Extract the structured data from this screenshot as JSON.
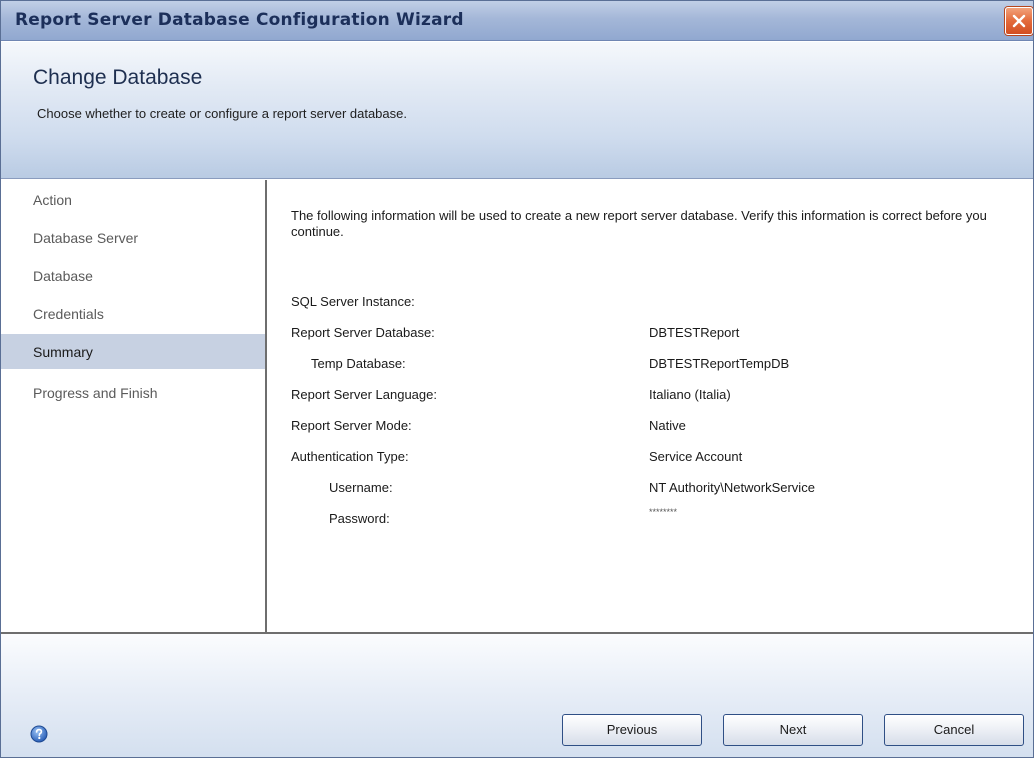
{
  "window": {
    "title": "Report Server Database Configuration Wizard"
  },
  "header": {
    "title": "Change Database",
    "subtitle": "Choose whether to create or configure a report server database."
  },
  "sidebar": {
    "items": [
      {
        "label": "Action"
      },
      {
        "label": "Database Server"
      },
      {
        "label": "Database"
      },
      {
        "label": "Credentials"
      },
      {
        "label": "Summary",
        "active": true
      },
      {
        "label": "Progress and Finish"
      }
    ]
  },
  "summary": {
    "intro": "The following information will be used to create a new report server database. Verify this information is correct before you continue.",
    "rows": [
      {
        "label": "SQL Server Instance:",
        "value": ""
      },
      {
        "label": "Report Server Database:",
        "value": "DBTESTReport"
      },
      {
        "label": "Temp Database:",
        "value": "DBTESTReportTempDB"
      },
      {
        "label": "Report Server Language:",
        "value": "Italiano (Italia)"
      },
      {
        "label": "Report Server Mode:",
        "value": "Native"
      },
      {
        "label": "Authentication Type:",
        "value": "Service Account"
      },
      {
        "label": "Username:",
        "value": "NT Authority\\NetworkService"
      },
      {
        "label": "Password:",
        "value": "********"
      }
    ]
  },
  "footer": {
    "previous_label": "Previous",
    "next_label": "Next",
    "cancel_label": "Cancel"
  },
  "colors": {
    "titlebar": "#a4b7d8",
    "active_nav": "#c7d1e2",
    "close_button": "#e36a3b"
  }
}
